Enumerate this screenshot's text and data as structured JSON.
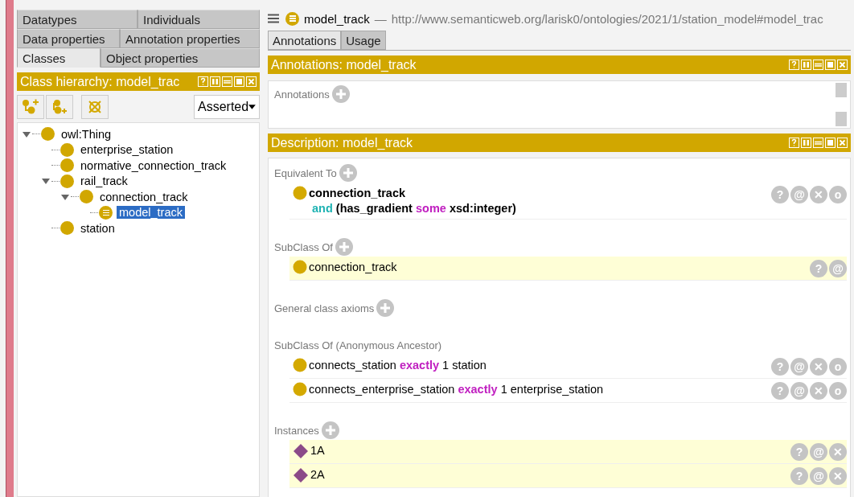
{
  "entity_tabs": [
    [
      {
        "label": "Datatypes",
        "selected": false
      },
      {
        "label": "Individuals",
        "selected": false
      }
    ],
    [
      {
        "label": "Data properties",
        "selected": false
      },
      {
        "label": "Annotation properties",
        "selected": false
      }
    ],
    [
      {
        "label": "Classes",
        "selected": true
      },
      {
        "label": "Object properties",
        "selected": false
      }
    ]
  ],
  "class_hierarchy": {
    "title": "Class hierarchy: model_trac",
    "mode": "Asserted",
    "tree": [
      {
        "label": "owl:Thing",
        "expanded": true,
        "selected": false,
        "defined": false,
        "children": [
          {
            "label": "enterprise_station",
            "selected": false,
            "defined": false
          },
          {
            "label": "normative_connection_track",
            "selected": false,
            "defined": false
          },
          {
            "label": "rail_track",
            "expanded": true,
            "selected": false,
            "defined": false,
            "children": [
              {
                "label": "connection_track",
                "expanded": true,
                "selected": false,
                "defined": false,
                "children": [
                  {
                    "label": "model_track",
                    "selected": true,
                    "defined": true
                  }
                ]
              }
            ]
          },
          {
            "label": "station",
            "selected": false,
            "defined": false
          }
        ]
      }
    ]
  },
  "header": {
    "name": "model_track",
    "dash": "—",
    "iri": "http://www.semanticweb.org/larisk0/ontologies/2021/1/station_model#model_trac"
  },
  "view_tabs": [
    {
      "label": "Annotations",
      "selected": true
    },
    {
      "label": "Usage",
      "selected": false
    }
  ],
  "annotations_view": {
    "title": "Annotations: model_track",
    "label": "Annotations"
  },
  "description_view": {
    "title": "Description: model_track",
    "sections": [
      {
        "label": "Equivalent To",
        "addable": true,
        "rows": [
          {
            "kind": "class",
            "highlighted": false,
            "bold": true,
            "lines": [
              [
                {
                  "text": "connection_track",
                  "kind": "name"
                }
              ],
              [
                {
                  "text": "and",
                  "kind": "and"
                },
                {
                  "text": "(has_gradient",
                  "kind": "name"
                },
                {
                  "text": "some",
                  "kind": "quantifier"
                },
                {
                  "text": "xsd:integer)",
                  "kind": "name"
                }
              ]
            ],
            "buttons": [
              "?",
              "@",
              "✕",
              "o"
            ]
          }
        ]
      },
      {
        "label": "SubClass Of",
        "addable": true,
        "rows": [
          {
            "kind": "class",
            "highlighted": true,
            "bold": false,
            "lines": [
              [
                {
                  "text": "connection_track",
                  "kind": "name"
                }
              ]
            ],
            "buttons": [
              "?",
              "@"
            ]
          }
        ]
      },
      {
        "label": "General class axioms",
        "addable": true
      },
      {
        "label": "SubClass Of (Anonymous Ancestor)",
        "addable": false,
        "rows": [
          {
            "kind": "class",
            "highlighted": false,
            "bold": false,
            "lines": [
              [
                {
                  "text": "connects_station",
                  "kind": "name"
                },
                {
                  "text": "exactly",
                  "kind": "quantifier"
                },
                {
                  "text": "1 station",
                  "kind": "name"
                }
              ]
            ],
            "buttons": [
              "?",
              "@",
              "✕",
              "o"
            ]
          },
          {
            "kind": "class",
            "highlighted": false,
            "bold": false,
            "lines": [
              [
                {
                  "text": "connects_enterprise_station",
                  "kind": "name"
                },
                {
                  "text": "exactly",
                  "kind": "quantifier"
                },
                {
                  "text": "1 enterprise_station",
                  "kind": "name"
                }
              ]
            ],
            "buttons": [
              "?",
              "@",
              "✕",
              "o"
            ]
          }
        ]
      },
      {
        "label": "Instances",
        "addable": true,
        "rows": [
          {
            "kind": "individual",
            "highlighted": true,
            "bold": false,
            "lines": [
              [
                {
                  "text": "1A",
                  "kind": "name"
                }
              ]
            ],
            "buttons": [
              "?",
              "@",
              "✕"
            ]
          },
          {
            "kind": "individual",
            "highlighted": true,
            "bold": false,
            "lines": [
              [
                {
                  "text": "2A",
                  "kind": "name"
                }
              ]
            ],
            "buttons": [
              "?",
              "@",
              "✕"
            ]
          }
        ]
      }
    ]
  }
}
